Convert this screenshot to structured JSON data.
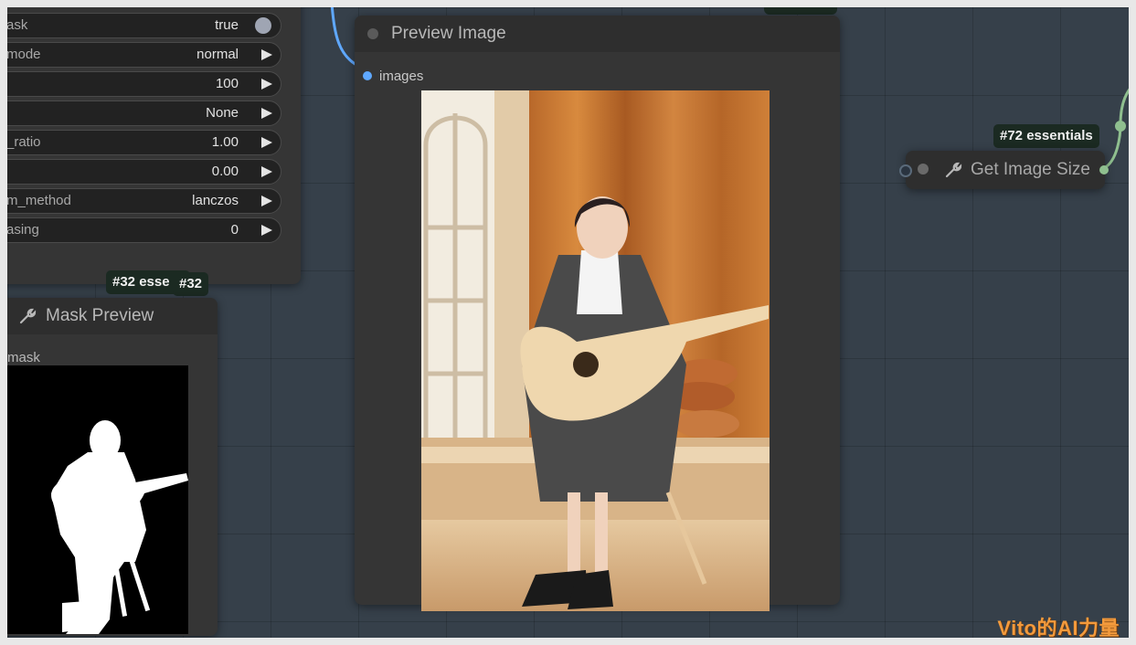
{
  "left_node": {
    "widgets": [
      {
        "label": "ask",
        "value": "true",
        "control": "toggle"
      },
      {
        "label": "mode",
        "value": "normal",
        "control": "arrow"
      },
      {
        "label": "",
        "value": "100",
        "control": "arrow"
      },
      {
        "label": "",
        "value": "None",
        "control": "arrow"
      },
      {
        "label": "_ratio",
        "value": "1.00",
        "control": "arrow"
      },
      {
        "label": "",
        "value": "0.00",
        "control": "arrow"
      },
      {
        "label": "m_method",
        "value": "lanczos",
        "control": "arrow"
      },
      {
        "label": "asing",
        "value": "0",
        "control": "arrow"
      }
    ]
  },
  "mask_preview_node": {
    "badge_a": "#32 esse",
    "badge_b": "#32",
    "title": "Mask Preview",
    "input_label": "mask",
    "title_icon": "wrench-icon"
  },
  "preview_image_node": {
    "title": "Preview Image",
    "input_label": "images"
  },
  "get_image_size_node": {
    "badge": "#72 essentials",
    "title": "Get Image Size",
    "title_icon": "wrench-icon"
  },
  "watermark": "Vito的AI力量",
  "colors": {
    "canvas": "#36404a",
    "node_body": "#353535",
    "node_title": "#2e2e2e",
    "link_blue": "#5fa8ff",
    "link_green": "#8fbf8f",
    "badge_bg": "#1b2a22",
    "watermark": "#f39a3c"
  }
}
